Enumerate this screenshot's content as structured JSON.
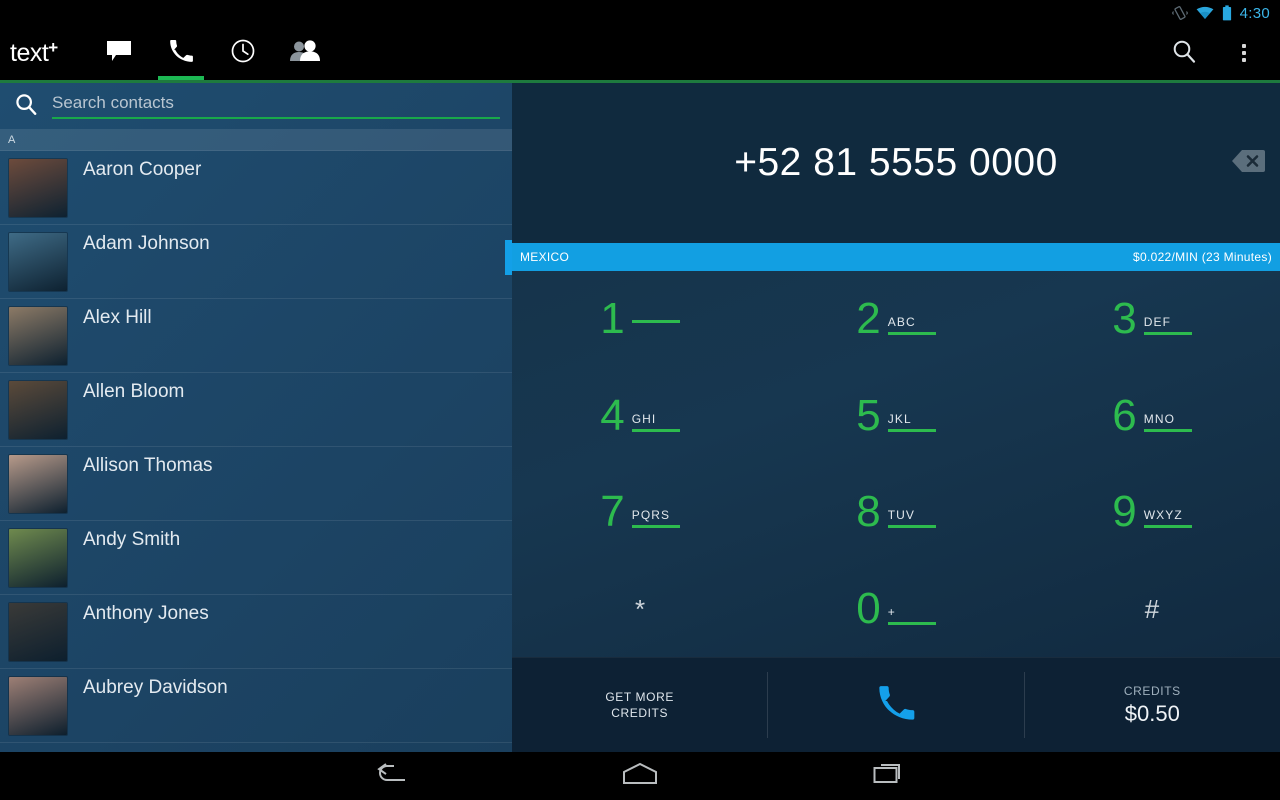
{
  "status_bar": {
    "time": "4:30",
    "icons": [
      "vibrate-icon",
      "wifi-icon",
      "battery-icon"
    ]
  },
  "action_bar": {
    "logo_text": "text",
    "logo_plus": "+",
    "tabs": [
      {
        "name": "messages",
        "icon": "message-bubble-icon",
        "active": false
      },
      {
        "name": "phone",
        "icon": "phone-handset-icon",
        "active": true
      },
      {
        "name": "recents",
        "icon": "clock-icon",
        "active": false
      },
      {
        "name": "contacts",
        "icon": "people-icon",
        "active": false
      }
    ],
    "search_icon": "search-icon",
    "overflow_icon": "overflow-menu-icon"
  },
  "contacts_pane": {
    "search": {
      "placeholder": "Search contacts",
      "value": "",
      "icon": "search-icon"
    },
    "section_header": "A",
    "items": [
      {
        "name": "Aaron Cooper",
        "avatar": "#6d4b3c"
      },
      {
        "name": "Adam Johnson",
        "avatar": "#3f6b86"
      },
      {
        "name": "Alex Hill",
        "avatar": "#8c7a66"
      },
      {
        "name": "Allen Bloom",
        "avatar": "#5b4a3a"
      },
      {
        "name": "Allison Thomas",
        "avatar": "#b79a8a"
      },
      {
        "name": "Andy Smith",
        "avatar": "#6f8a4e"
      },
      {
        "name": "Anthony Jones",
        "avatar": "#3a3a38"
      },
      {
        "name": "Aubrey Davidson",
        "avatar": "#9d7f75"
      }
    ]
  },
  "dialer": {
    "number": "+52 81 5555 0000",
    "backspace_icon": "backspace-delete-icon",
    "rate_banner": {
      "country": "MEXICO",
      "rate": "$0.022/MIN (23 Minutes)",
      "color": "#129fe2"
    },
    "keys": [
      {
        "digit": "1",
        "letters": "",
        "bar": true,
        "symbol": false
      },
      {
        "digit": "2",
        "letters": "ABC",
        "bar": true,
        "symbol": false
      },
      {
        "digit": "3",
        "letters": "DEF",
        "bar": true,
        "symbol": false
      },
      {
        "digit": "4",
        "letters": "GHI",
        "bar": true,
        "symbol": false
      },
      {
        "digit": "5",
        "letters": "JKL",
        "bar": true,
        "symbol": false
      },
      {
        "digit": "6",
        "letters": "MNO",
        "bar": true,
        "symbol": false
      },
      {
        "digit": "7",
        "letters": "PQRS",
        "bar": true,
        "symbol": false
      },
      {
        "digit": "8",
        "letters": "TUV",
        "bar": true,
        "symbol": false
      },
      {
        "digit": "9",
        "letters": "WXYZ",
        "bar": true,
        "symbol": false
      },
      {
        "digit": "*",
        "letters": "",
        "bar": false,
        "symbol": true
      },
      {
        "digit": "0",
        "letters": "+",
        "bar": true,
        "symbol": false
      },
      {
        "digit": "#",
        "letters": "",
        "bar": false,
        "symbol": true
      }
    ],
    "digit_color": "#2dbb4e"
  },
  "bottom_bar": {
    "get_more_credits_line1": "GET MORE",
    "get_more_credits_line2": "CREDITS",
    "call_icon": "phone-call-icon",
    "credits_label": "CREDITS",
    "credits_value": "$0.50",
    "call_button_color": "#14a0ea"
  },
  "nav_bar": {
    "back": "back-icon",
    "home": "home-icon",
    "recents": "recents-icon"
  }
}
